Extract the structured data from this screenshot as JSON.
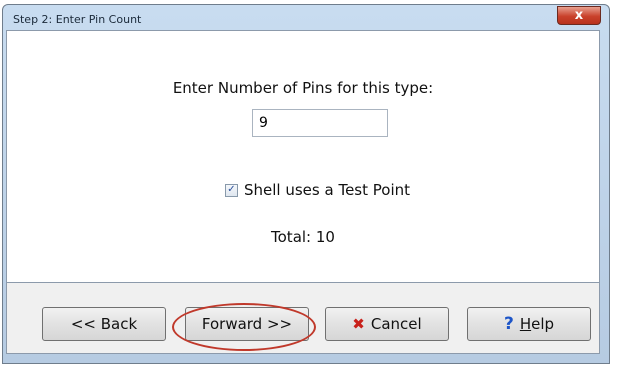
{
  "window": {
    "title": "Step 2: Enter Pin Count",
    "close_label": "x"
  },
  "form": {
    "prompt": "Enter Number of Pins for this type:",
    "pin_count_value": "9",
    "checkbox_label": "Shell uses a Test Point",
    "checkbox_checked": true,
    "total_text": "Total: 10"
  },
  "buttons": {
    "back": "<< Back",
    "forward": "Forward >>",
    "cancel": "Cancel",
    "help_prefix": "H",
    "help_rest": "elp"
  },
  "icons": {
    "cancel": "x-icon",
    "help": "question-icon",
    "checkbox": "checkmark-icon"
  },
  "colors": {
    "highlight": "#c0392b",
    "cancel_icon": "#c8201a",
    "help_icon": "#1d55c8"
  }
}
